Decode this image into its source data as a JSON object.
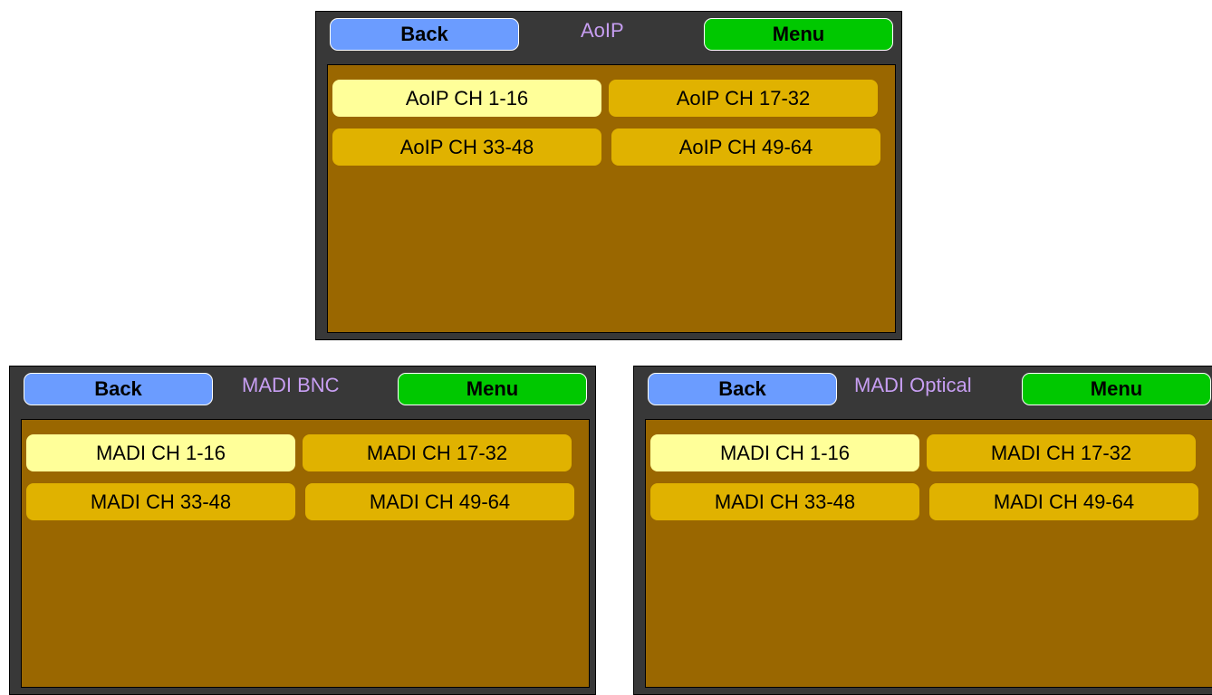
{
  "colors": {
    "panel_bg": "#383838",
    "content_bg": "#9a6700",
    "back_button": "#6b9cff",
    "menu_button": "#00c800",
    "channel_button": "#e0b200",
    "channel_button_selected": "#ffff99",
    "title_text": "#c79ef2"
  },
  "panels": {
    "aoip": {
      "title": "AoIP",
      "back_label": "Back",
      "menu_label": "Menu",
      "channels": [
        "AoIP CH 1-16",
        "AoIP CH 17-32",
        "AoIP CH 33-48",
        "AoIP CH 49-64"
      ],
      "selected_index": 0
    },
    "madi_bnc": {
      "title": "MADI BNC",
      "back_label": "Back",
      "menu_label": "Menu",
      "channels": [
        "MADI CH 1-16",
        "MADI CH 17-32",
        "MADI CH 33-48",
        "MADI CH 49-64"
      ],
      "selected_index": 0
    },
    "madi_optical": {
      "title": "MADI Optical",
      "back_label": "Back",
      "menu_label": "Menu",
      "channels": [
        "MADI CH 1-16",
        "MADI CH 17-32",
        "MADI CH 33-48",
        "MADI CH 49-64"
      ],
      "selected_index": 0
    }
  }
}
